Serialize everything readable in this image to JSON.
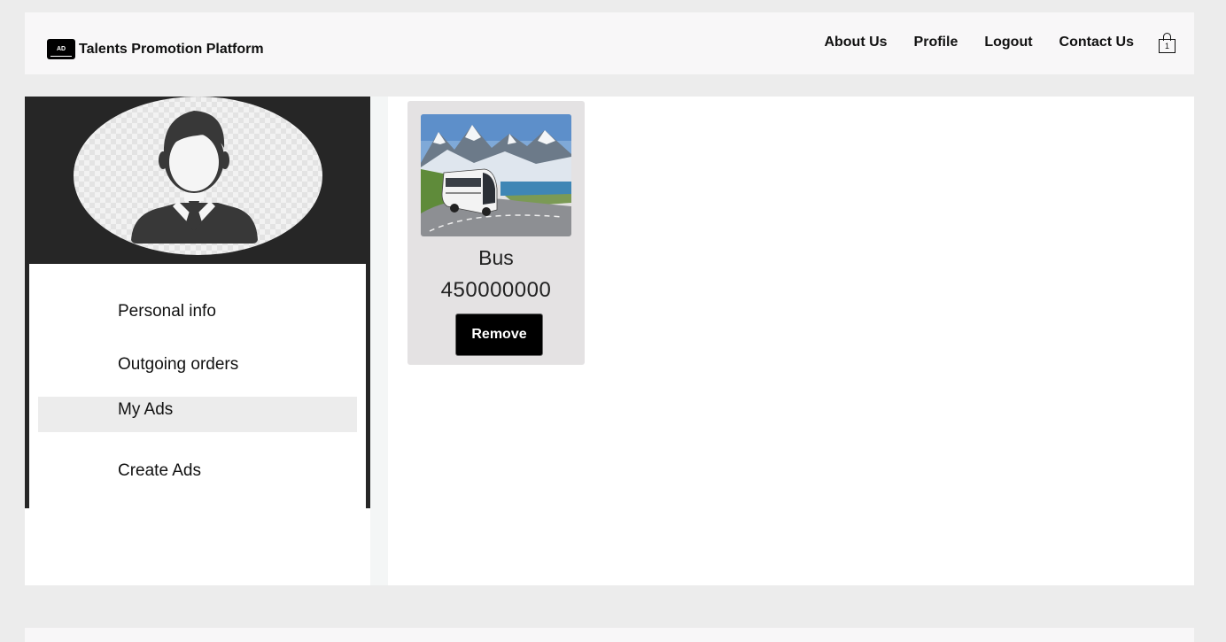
{
  "header": {
    "logo_text": "AD",
    "brand_title": "Talents Promotion Platform",
    "nav": [
      "About Us",
      "Profile",
      "Logout",
      "Contact Us"
    ],
    "cart_count": "1"
  },
  "sidebar": {
    "menu": [
      "Personal info",
      "Outgoing orders",
      "My Ads",
      "Create Ads"
    ],
    "active_item": "My Ads"
  },
  "ads": [
    {
      "title": "Bus",
      "price": "450000000",
      "remove_label": "Remove"
    }
  ],
  "colors": {
    "page_bg": "#ececec",
    "header_bg": "#f8f7f8",
    "sidebar_dark": "#262626",
    "card_bg": "#e4e2e3",
    "button_bg": "#000000",
    "active_menu_bg": "#ececec"
  }
}
